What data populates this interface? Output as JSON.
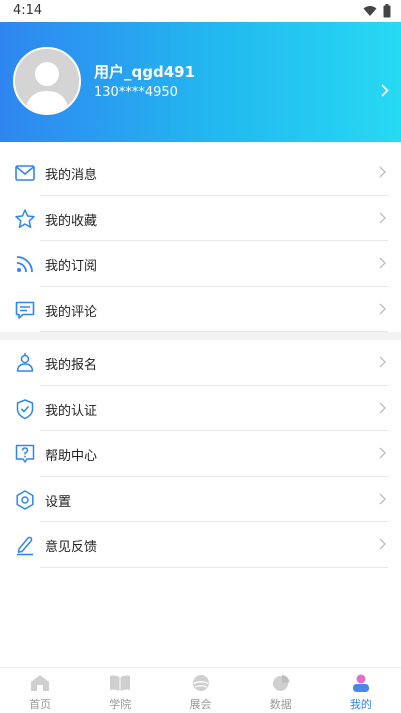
{
  "status": {
    "time": "4:14"
  },
  "profile": {
    "name": "用户_qgd491",
    "phone": "130****4950"
  },
  "menu_group_1": [
    {
      "label": "我的消息",
      "icon": "mail-icon"
    },
    {
      "label": "我的收藏",
      "icon": "star-icon"
    },
    {
      "label": "我的订阅",
      "icon": "rss-icon"
    },
    {
      "label": "我的评论",
      "icon": "comment-icon"
    }
  ],
  "menu_group_2": [
    {
      "label": "我的报名",
      "icon": "signup-icon"
    },
    {
      "label": "我的认证",
      "icon": "shield-check-icon"
    },
    {
      "label": "帮助中心",
      "icon": "help-icon"
    },
    {
      "label": "设置",
      "icon": "settings-icon"
    },
    {
      "label": "意见反馈",
      "icon": "feedback-pen-icon"
    }
  ],
  "tabs": [
    {
      "label": "首页",
      "icon": "home-icon"
    },
    {
      "label": "学院",
      "icon": "book-icon"
    },
    {
      "label": "展会",
      "icon": "expo-icon"
    },
    {
      "label": "数据",
      "icon": "pie-chart-icon"
    },
    {
      "label": "我的",
      "icon": "person-icon",
      "active": true
    }
  ],
  "colors": {
    "accent": "#2f86f0",
    "gradient_start": "#2f86f0",
    "gradient_end": "#27d9f3",
    "inactive": "#9a9a9a"
  }
}
